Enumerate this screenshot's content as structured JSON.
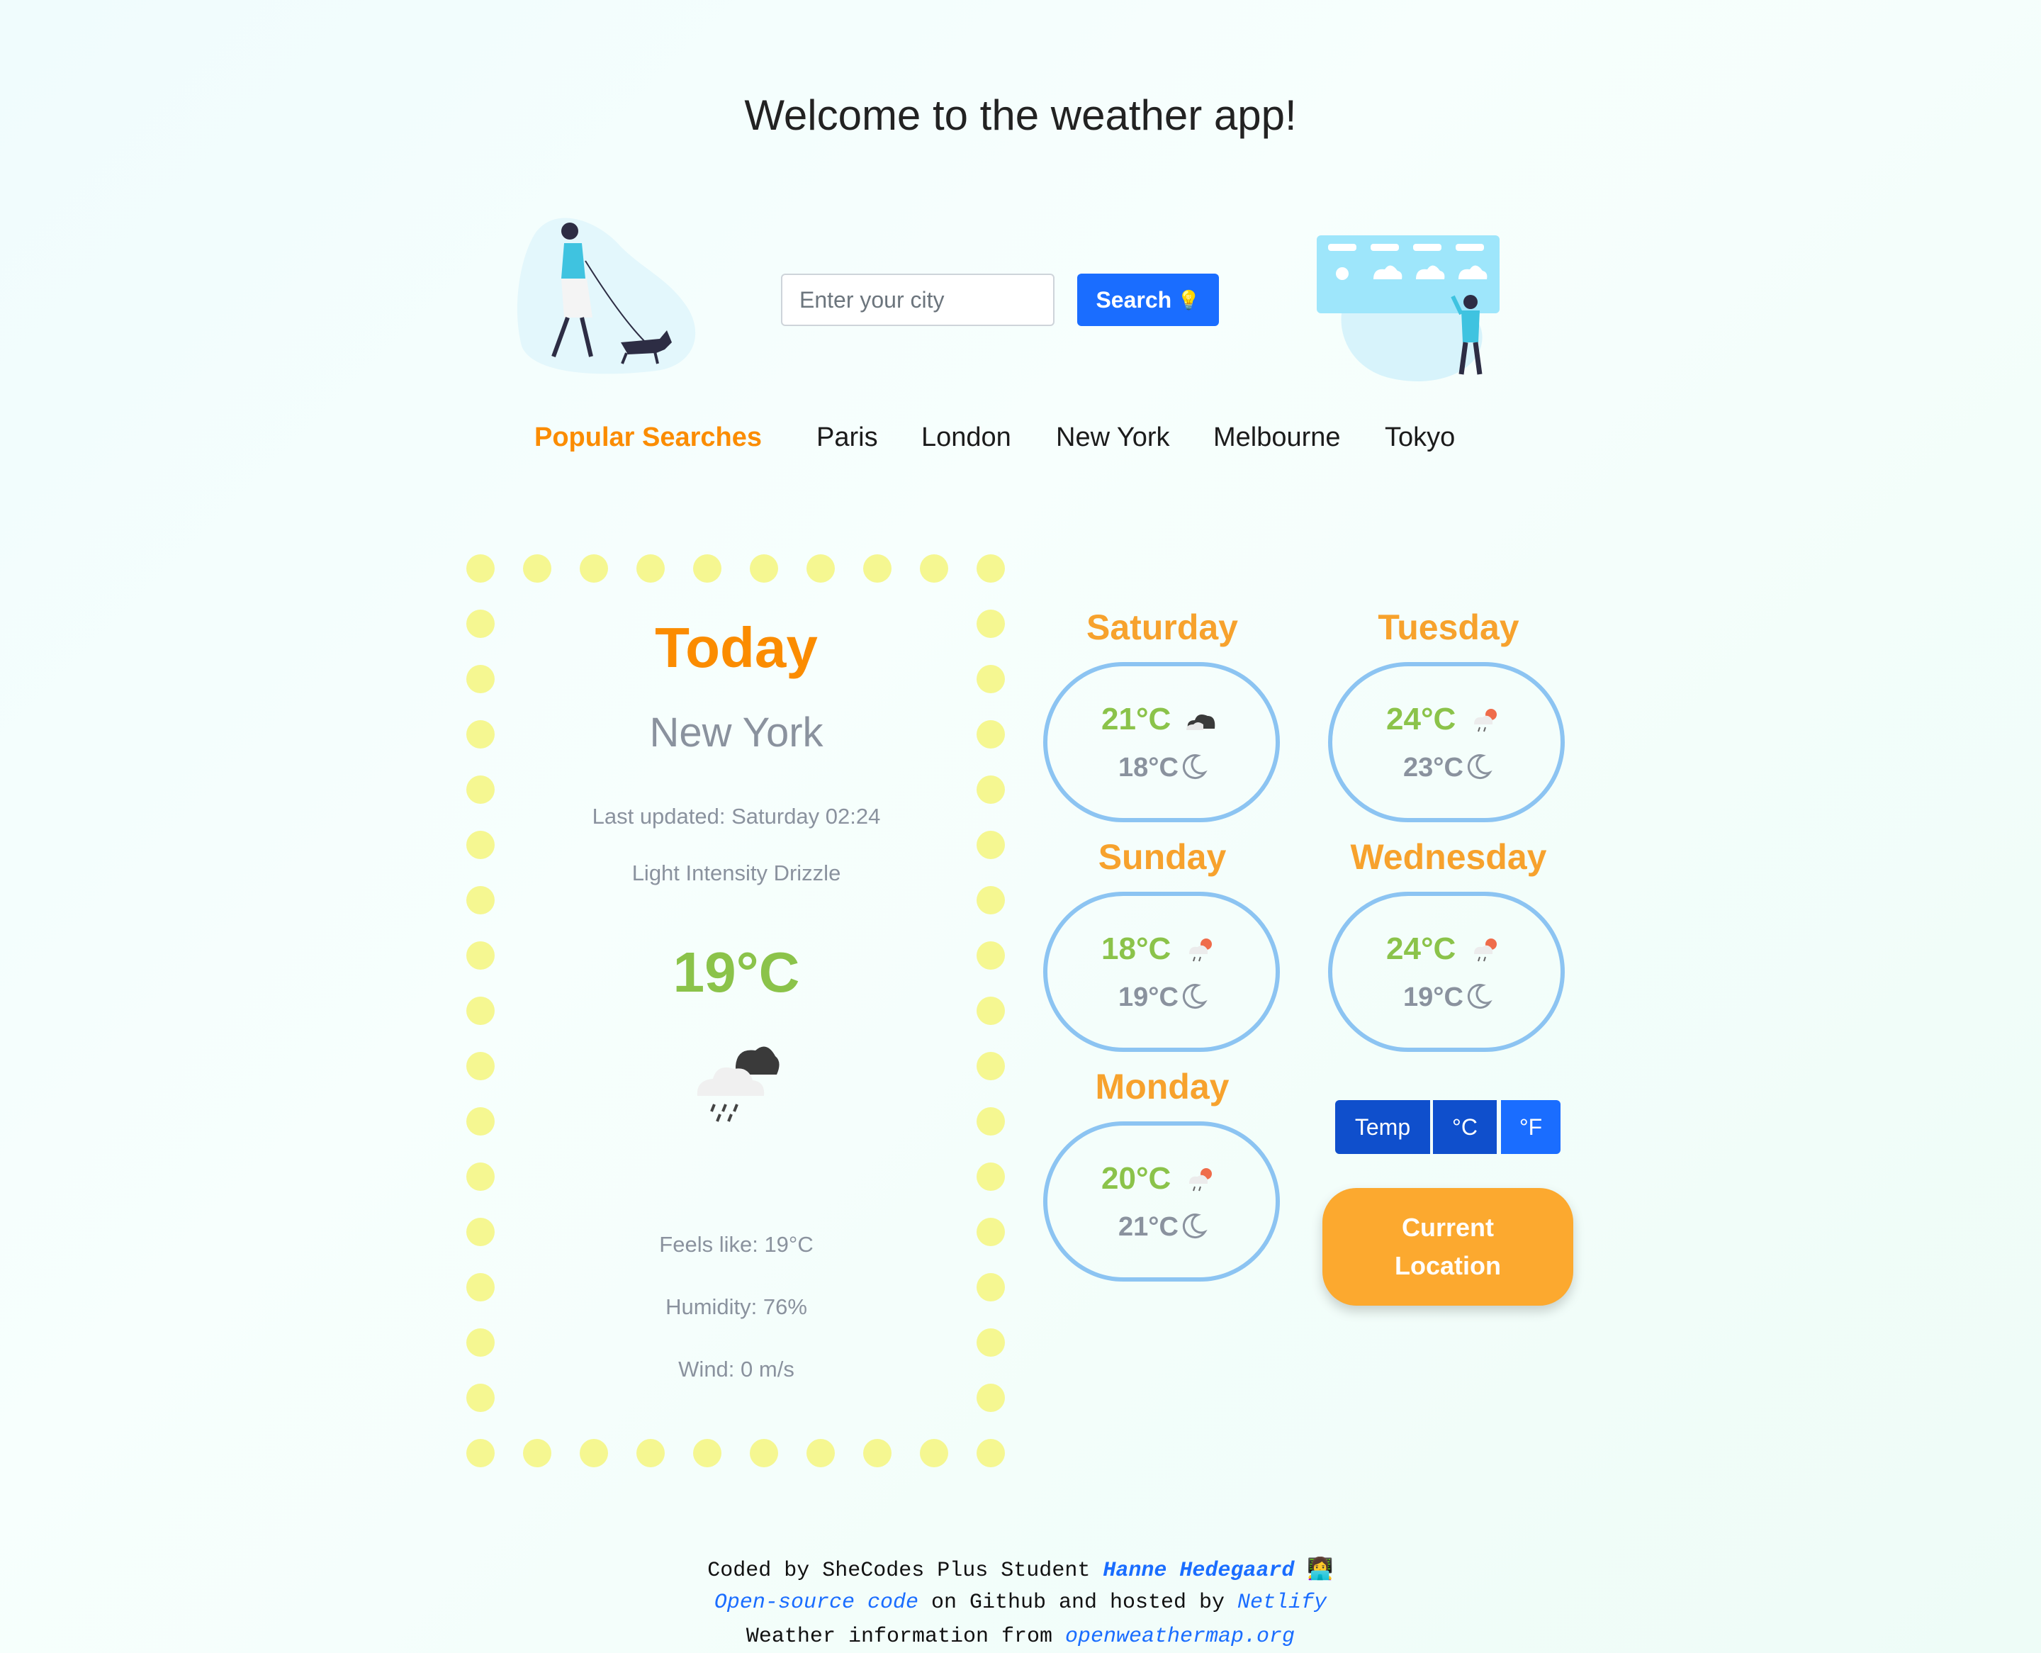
{
  "header": {
    "title": "Welcome to the weather app!"
  },
  "search": {
    "placeholder": "Enter your city",
    "button_label": "Search",
    "button_icon": "💡"
  },
  "popular": {
    "heading": "Popular Searches",
    "cities": [
      "Paris",
      "London",
      "New York",
      "Melbourne",
      "Tokyo"
    ]
  },
  "today": {
    "title": "Today",
    "city": "New York",
    "last_updated": "Last updated: Saturday 02:24",
    "description": "Light Intensity Drizzle",
    "temperature": "19°C",
    "icon": "rain-cloud-icon",
    "feels_like": "Feels like: 19°C",
    "humidity": "Humidity: 76%",
    "wind": "Wind: 0 m/s"
  },
  "forecast": [
    {
      "day": "Saturday",
      "high": "21°C",
      "low": "18°C",
      "icon": "cloud-icon"
    },
    {
      "day": "Tuesday",
      "high": "24°C",
      "low": "23°C",
      "icon": "sun-rain-icon"
    },
    {
      "day": "Sunday",
      "high": "18°C",
      "low": "19°C",
      "icon": "sun-rain-icon"
    },
    {
      "day": "Wednesday",
      "high": "24°C",
      "low": "19°C",
      "icon": "sun-rain-icon"
    },
    {
      "day": "Monday",
      "high": "20°C",
      "low": "21°C",
      "icon": "sun-rain-icon"
    }
  ],
  "units": {
    "label": "Temp",
    "celsius": "°C",
    "fahrenheit": "°F"
  },
  "location_button": {
    "line1": "Current",
    "line2": "Location"
  },
  "footer": {
    "line1_prefix": "Coded by SheCodes Plus Student ",
    "author": "Hanne Hedegaard",
    "author_emoji": "👩‍💻",
    "code_link": "Open-source code",
    "line2_middle": " on Github and hosted by ",
    "host_link": "Netlify",
    "line3_prefix": "Weather information from ",
    "weather_link": "openweathermap.org"
  },
  "colors": {
    "accent_orange": "#fb8c00",
    "temp_green": "#8bc34a",
    "button_blue": "#1a6dff",
    "oval_border": "#8cc4f2",
    "dot_yellow": "#f5f791"
  }
}
